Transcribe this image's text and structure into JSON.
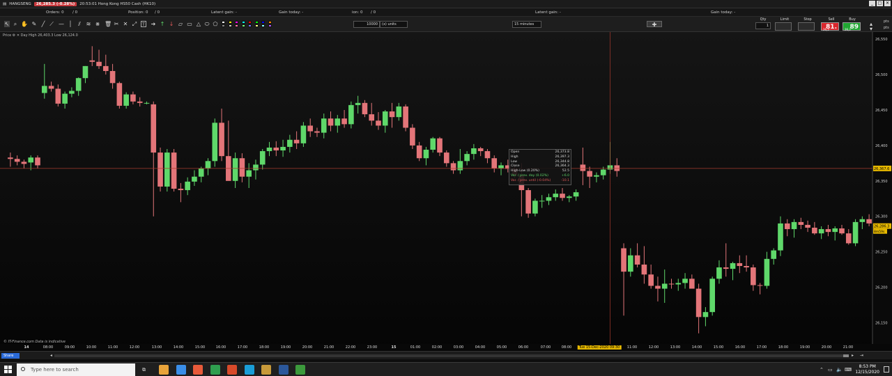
{
  "titlebar": {
    "instrument": "HANGSENG",
    "price_badge": "26,285.3 (-0.28%)",
    "title": "20:53:01 Hong Kong HS50 Cash (HK10)",
    "window_buttons": [
      "_",
      "□",
      "✕"
    ]
  },
  "infobar": {
    "orders": "Orders: 0",
    "orders_value": "/ 0",
    "position": "Position: 0",
    "position_value": "/ 0",
    "latent_gain_1": "Latent gain: -",
    "gain_today_1": "Gain today: -",
    "ion": "ion: 0",
    "ion_value": "/ 0",
    "latent_gain_2": "Latent gain: -",
    "gain_today_2": "Gain today: -"
  },
  "toolbar": {
    "quantity": "10000",
    "units": "(x) units",
    "timeframe": "15 minutes",
    "order_labels": [
      "Qty",
      "Limit",
      "Stop",
      "Sell",
      "Buy"
    ],
    "qty_value": "1",
    "sell": {
      "small": "26,2",
      "big": "81.",
      "color": "#d9262d"
    },
    "buy": {
      "small": "26,2",
      "big": "89",
      "color": "#21a732"
    },
    "side_labels": [
      "pts",
      "pts"
    ],
    "swatch_colors": [
      "#ffffff",
      "#ffff00",
      "#ff00ff",
      "#00ffff",
      "#ff0000",
      "#00ff00",
      "#0000ff",
      "#ff8800",
      "#888888",
      "#cccccc",
      "#ff77aa",
      "#77ff77",
      "#7777ff",
      "#ffff88",
      "#88ffff",
      "#aa55ff"
    ]
  },
  "chart": {
    "header": "Price",
    "day_range": "Day High 26,403.3  Low 26,124.0",
    "watermark": "© IT-Finance.com  Data is indicative",
    "current_price_label": "26,367.6",
    "last_price_label": "26,286.3",
    "countdown_label": "8m59s",
    "tooltip": {
      "rows": [
        {
          "label": "Open",
          "value": "26,373.8"
        },
        {
          "label": "High",
          "value": "26,397.3"
        },
        {
          "label": "Low",
          "value": "26,344.8"
        },
        {
          "label": "Close",
          "value": "26,364.3"
        },
        {
          "label": "High-Low (0.20%)",
          "value": "52.5"
        },
        {
          "label": "Var. / prev. day (0.02%)",
          "value": "+6.0"
        },
        {
          "label": "Var. / prev. until (-0.04%)",
          "value": "-10.1"
        }
      ]
    },
    "colors": {
      "up": "#5fd86a",
      "down": "#e37579",
      "crosshair": "#a83a2e"
    }
  },
  "chart_data": {
    "type": "candlestick",
    "instrument": "Hong Kong HS50 Cash (HK10)",
    "timeframe": "15 minutes",
    "ylim": [
      26120,
      26560
    ],
    "y_ticks": [
      26550,
      26500,
      26450,
      26400,
      26350,
      26300,
      26250,
      26200,
      26150
    ],
    "x_ticks": [
      "14",
      "08:00",
      "09:00",
      "10:00",
      "11:00",
      "12:00",
      "13:00",
      "14:00",
      "15:00",
      "16:00",
      "17:00",
      "18:00",
      "19:00",
      "20:00",
      "21:00",
      "22:00",
      "23:00",
      "15",
      "01:00",
      "02:00",
      "03:00",
      "04:00",
      "05:00",
      "06:00",
      "07:00",
      "08:00",
      "Tue 15-Dec-2020 09:30",
      "11:00",
      "12:00",
      "13:00",
      "14:00",
      "15:00",
      "16:00",
      "17:00",
      "18:00",
      "19:00",
      "20:00",
      "21:00"
    ],
    "candles": [
      [
        26383,
        26390,
        26370,
        26381
      ],
      [
        26381,
        26386,
        26372,
        26377
      ],
      [
        26377,
        26380,
        26368,
        26374
      ],
      [
        26376,
        26386,
        26365,
        26383
      ],
      [
        26383,
        26386,
        26368,
        26372
      ],
      [
        26474,
        26515,
        26466,
        26484
      ],
      [
        26484,
        26490,
        26476,
        26480
      ],
      [
        26480,
        26486,
        26455,
        26459
      ],
      [
        26459,
        26476,
        26452,
        26473
      ],
      [
        26473,
        26482,
        26468,
        26477
      ],
      [
        26477,
        26496,
        26470,
        26495
      ],
      [
        26495,
        26512,
        26488,
        26512
      ],
      [
        26520,
        26540,
        26512,
        26518
      ],
      [
        26518,
        26535,
        26508,
        26512
      ],
      [
        26512,
        26528,
        26500,
        26505
      ],
      [
        26505,
        26515,
        26480,
        26488
      ],
      [
        26488,
        26490,
        26452,
        26456
      ],
      [
        26456,
        26475,
        26452,
        26472
      ],
      [
        26472,
        26476,
        26458,
        26462
      ],
      [
        26462,
        26468,
        26455,
        26460
      ],
      [
        26460,
        26462,
        26458,
        26460
      ],
      [
        26458,
        26462,
        26300,
        26390
      ],
      [
        26390,
        26397,
        26335,
        26342
      ],
      [
        26342,
        26395,
        26335,
        26390
      ],
      [
        26390,
        26395,
        26335,
        26339
      ],
      [
        26339,
        26347,
        26320,
        26337
      ],
      [
        26337,
        26355,
        26330,
        26349
      ],
      [
        26349,
        26365,
        26343,
        26356
      ],
      [
        26356,
        26370,
        26348,
        26368
      ],
      [
        26368,
        26382,
        26358,
        26378
      ],
      [
        26378,
        26438,
        26370,
        26432
      ],
      [
        26432,
        26452,
        26378,
        26385
      ],
      [
        26385,
        26435,
        26355,
        26350
      ],
      [
        26350,
        26390,
        26340,
        26382
      ],
      [
        26382,
        26389,
        26348,
        26356
      ],
      [
        26356,
        26375,
        26340,
        26365
      ],
      [
        26365,
        26380,
        26352,
        26373
      ],
      [
        26373,
        26395,
        26366,
        26392
      ],
      [
        26392,
        26405,
        26385,
        26397
      ],
      [
        26397,
        26406,
        26385,
        26393
      ],
      [
        26393,
        26408,
        26384,
        26398
      ],
      [
        26398,
        26415,
        26390,
        26408
      ],
      [
        26408,
        26420,
        26395,
        26403
      ],
      [
        26403,
        26433,
        26398,
        26428
      ],
      [
        26428,
        26438,
        26412,
        26420
      ],
      [
        26420,
        26425,
        26412,
        26418
      ],
      [
        26418,
        26445,
        26410,
        26438
      ],
      [
        26438,
        26448,
        26420,
        26428
      ],
      [
        26428,
        26443,
        26418,
        26438
      ],
      [
        26438,
        26450,
        26425,
        26430
      ],
      [
        26430,
        26462,
        26424,
        26457
      ],
      [
        26457,
        26470,
        26445,
        26460
      ],
      [
        26460,
        26464,
        26440,
        26444
      ],
      [
        26444,
        26460,
        26428,
        26435
      ],
      [
        26435,
        26447,
        26422,
        26428
      ],
      [
        26428,
        26450,
        26418,
        26448
      ],
      [
        26448,
        26460,
        26425,
        26440
      ],
      [
        26440,
        26460,
        26435,
        26455
      ],
      [
        26455,
        26458,
        26420,
        26425
      ],
      [
        26425,
        26430,
        26395,
        26400
      ],
      [
        26400,
        26405,
        26378,
        26382
      ],
      [
        26382,
        26398,
        26372,
        26394
      ],
      [
        26394,
        26412,
        26390,
        26410
      ],
      [
        26410,
        26412,
        26385,
        26390
      ],
      [
        26390,
        26393,
        26370,
        26375
      ],
      [
        26375,
        26378,
        26360,
        26365
      ],
      [
        26365,
        26395,
        26360,
        26378
      ],
      [
        26378,
        26392,
        26372,
        26388
      ],
      [
        26388,
        26402,
        26380,
        26396
      ],
      [
        26396,
        26398,
        26385,
        26392
      ],
      [
        26392,
        26395,
        26375,
        26382
      ],
      [
        26382,
        26386,
        26362,
        26368
      ],
      [
        26368,
        26376,
        26358,
        26372
      ],
      [
        26372,
        26380,
        26362,
        26367
      ],
      [
        26367,
        26372,
        26354,
        26358
      ],
      [
        26358,
        26375,
        26300,
        26337
      ],
      [
        26337,
        26340,
        26298,
        26304
      ],
      [
        26304,
        26325,
        26300,
        26322
      ],
      [
        26322,
        26330,
        26312,
        26322
      ],
      [
        26322,
        26332,
        26316,
        26327
      ],
      [
        26327,
        26338,
        26322,
        26332
      ],
      [
        26332,
        26340,
        26322,
        26326
      ],
      [
        26326,
        26330,
        26320,
        26328
      ],
      [
        26328,
        26338,
        26322,
        26334
      ],
      [
        26373,
        26397,
        26344,
        26364
      ],
      [
        26364,
        26370,
        26340,
        26356
      ],
      [
        26356,
        26362,
        26348,
        26358
      ],
      [
        26358,
        26370,
        26352,
        26366
      ],
      [
        26366,
        26405,
        26360,
        26372
      ],
      [
        26372,
        26382,
        26356,
        26364
      ],
      [
        26255,
        26262,
        26160,
        26222
      ],
      [
        26222,
        26255,
        26215,
        26245
      ],
      [
        26245,
        26262,
        26228,
        26232
      ],
      [
        26232,
        26258,
        26205,
        26218
      ],
      [
        26218,
        26232,
        26198,
        26202
      ],
      [
        26202,
        26215,
        26180,
        26198
      ],
      [
        26198,
        26225,
        26178,
        26205
      ],
      [
        26205,
        26212,
        26198,
        26204
      ],
      [
        26204,
        26212,
        26195,
        26206
      ],
      [
        26206,
        26220,
        26198,
        26212
      ],
      [
        26212,
        26218,
        26200,
        26198
      ],
      [
        26198,
        26205,
        26135,
        26158
      ],
      [
        26158,
        26172,
        26145,
        26165
      ],
      [
        26165,
        26215,
        26160,
        26212
      ],
      [
        26212,
        26238,
        26205,
        26228
      ],
      [
        26228,
        26262,
        26215,
        26226
      ],
      [
        26226,
        26236,
        26210,
        26234
      ],
      [
        26234,
        26245,
        26220,
        26230
      ],
      [
        26230,
        26245,
        26222,
        26228
      ],
      [
        26228,
        26232,
        26195,
        26203
      ],
      [
        26203,
        26206,
        26190,
        26202
      ],
      [
        26202,
        26250,
        26198,
        26240
      ],
      [
        26240,
        26255,
        26232,
        26252
      ],
      [
        26252,
        26300,
        26244,
        26290
      ],
      [
        26290,
        26296,
        26272,
        26282
      ],
      [
        26282,
        26296,
        26270,
        26292
      ],
      [
        26292,
        26298,
        26282,
        26288
      ],
      [
        26288,
        26294,
        26278,
        26284
      ],
      [
        26284,
        26292,
        26274,
        26276
      ],
      [
        26276,
        26286,
        26268,
        26282
      ],
      [
        26282,
        26288,
        26272,
        26278
      ],
      [
        26278,
        26286,
        26266,
        26283
      ],
      [
        26283,
        26288,
        26274,
        26276
      ],
      [
        26276,
        26282,
        26260,
        26262
      ],
      [
        26262,
        26296,
        26258,
        26292
      ],
      [
        26292,
        26300,
        26282,
        26296
      ],
      [
        26296,
        26303,
        26286,
        26290
      ]
    ]
  },
  "scrollbar": {
    "share_label": "Share"
  },
  "taskbar": {
    "search_placeholder": "Type here to search",
    "time": "8:53 PM",
    "date": "12/15/2020",
    "app_colors": [
      "#e8a33a",
      "#3a8ee8",
      "#e85a3a",
      "#2f9e4f",
      "#d84a2a",
      "#1a9ed8",
      "#c89a3a",
      "#2b579a",
      "#3c9a3c"
    ]
  }
}
